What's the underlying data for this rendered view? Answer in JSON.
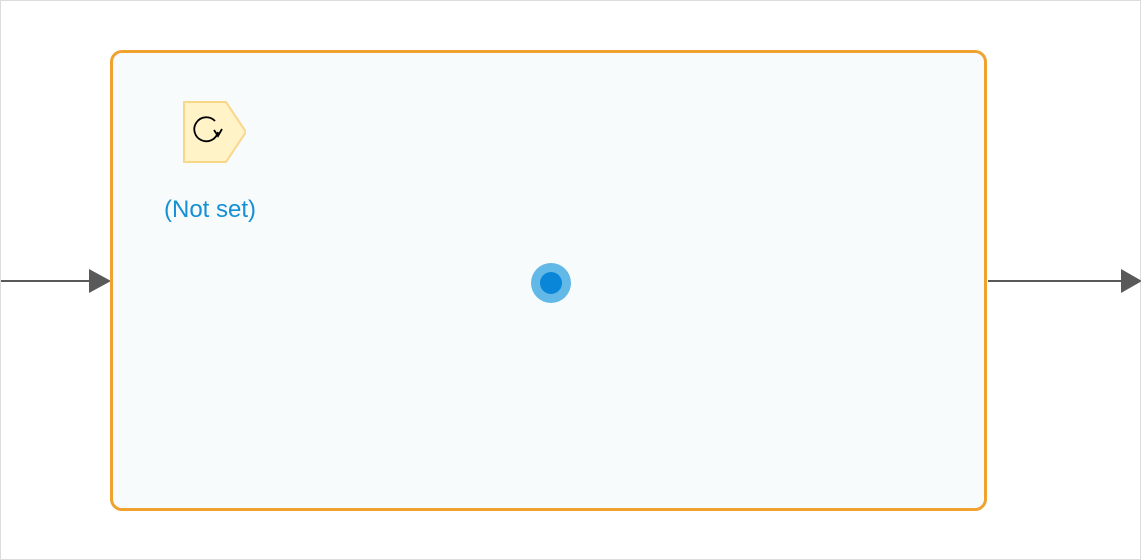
{
  "loop": {
    "label": "(Not set)",
    "type_icon": "loop-refresh-icon"
  },
  "connectors": {
    "incoming": "arrow-right-icon",
    "outgoing": "arrow-right-icon"
  },
  "colors": {
    "container_border": "#f0a12e",
    "container_fill": "#f8fbfc",
    "label_text": "#1590d4",
    "icon_fill": "#fff3c7",
    "icon_border": "#f8d78a",
    "connector": "#595959",
    "drop_point_outer": "#62b8e6",
    "drop_point_inner": "#0a86d8"
  }
}
